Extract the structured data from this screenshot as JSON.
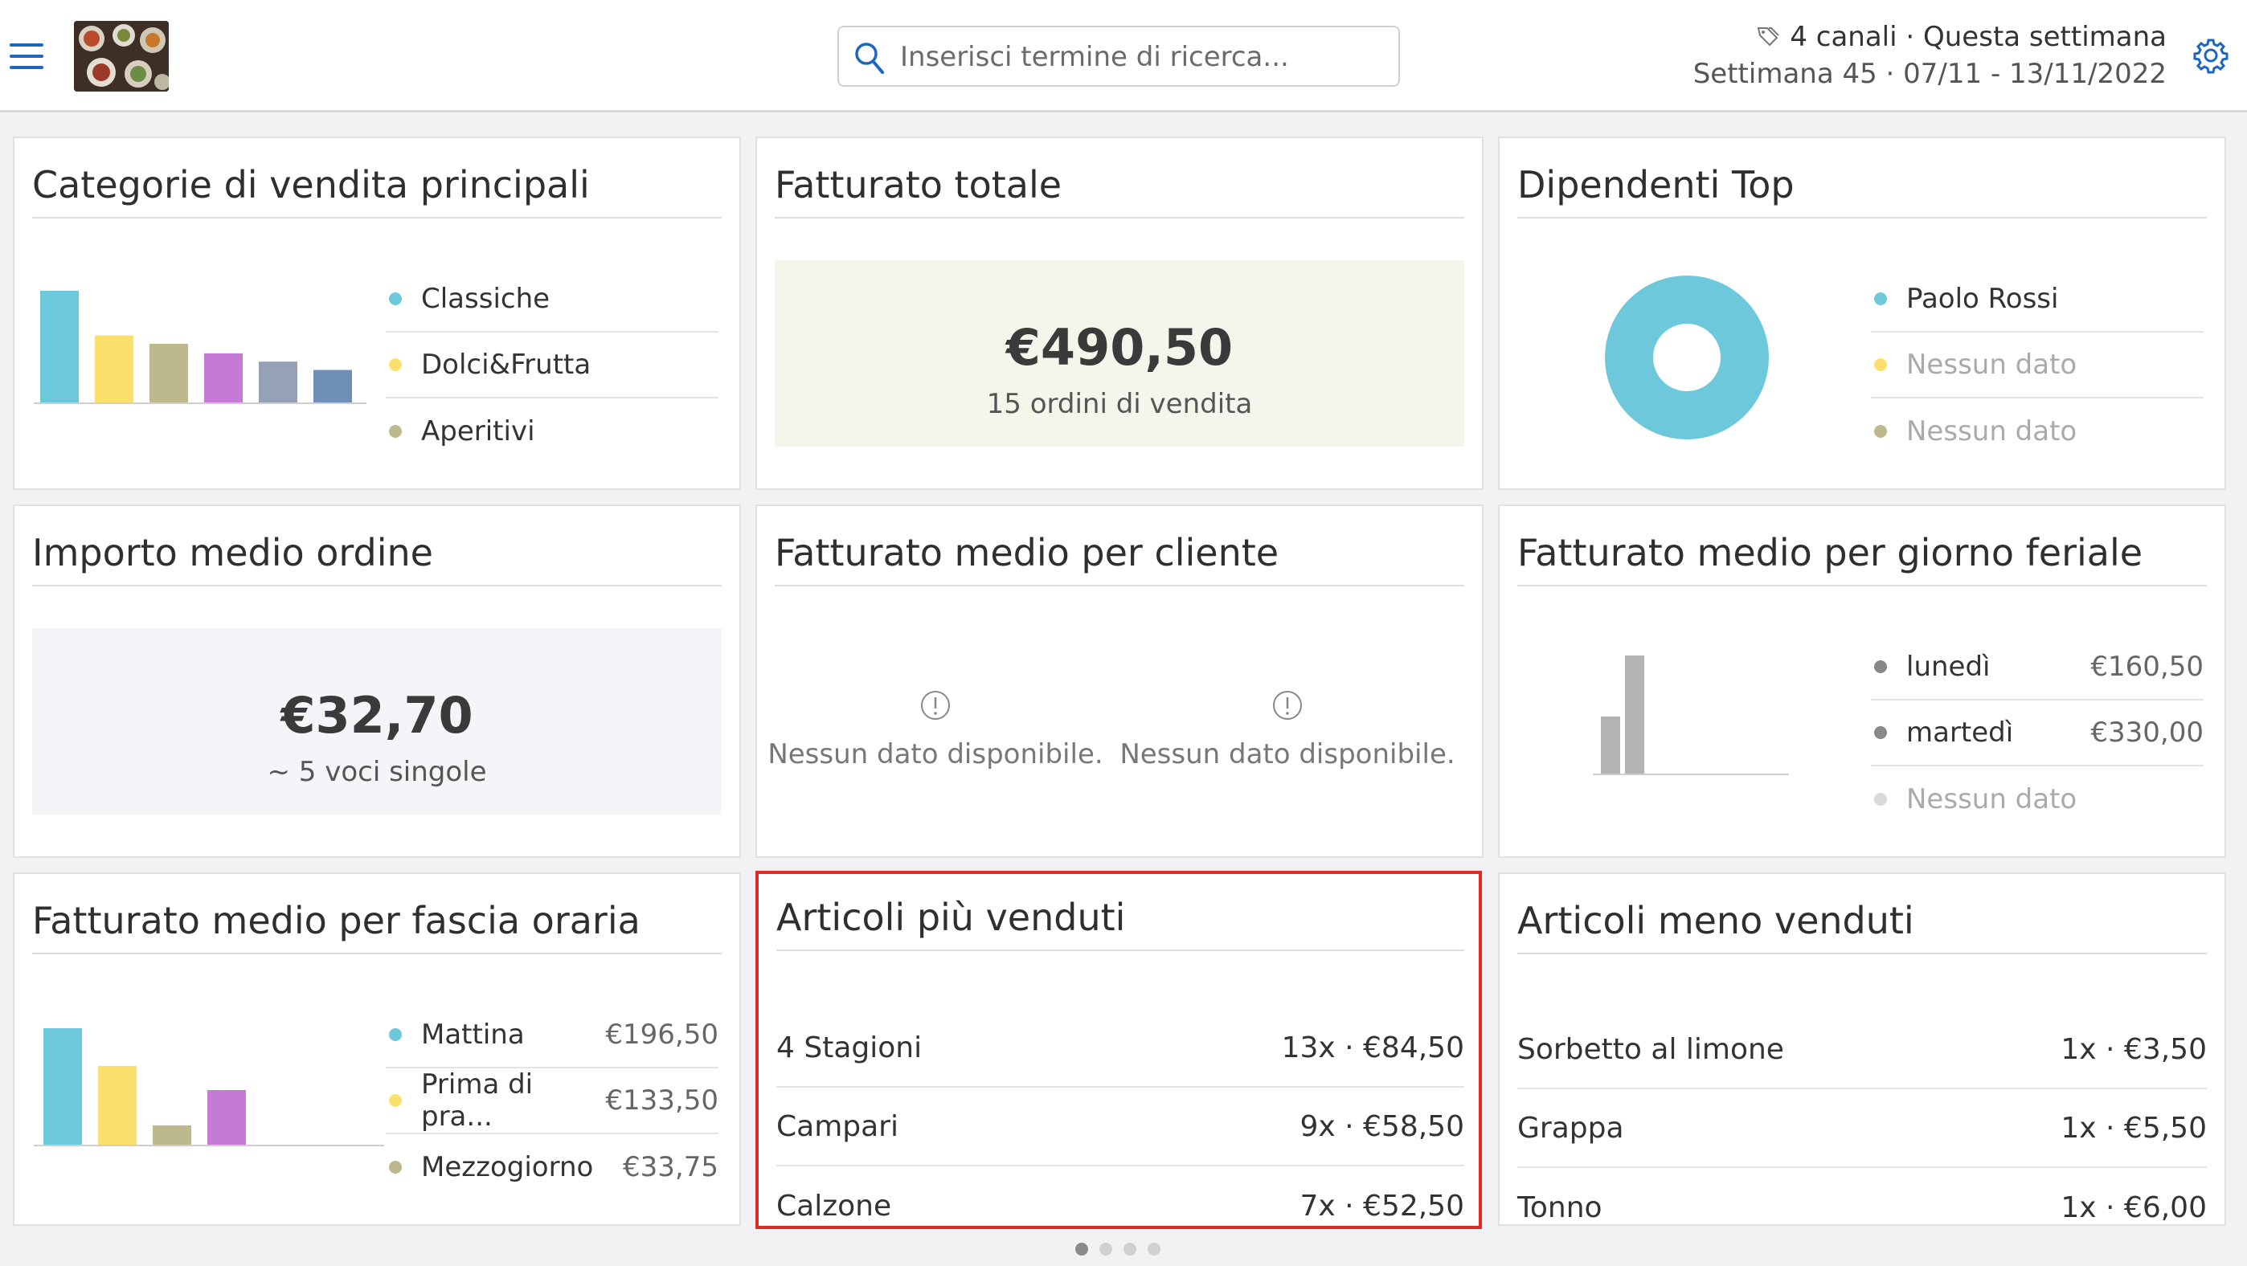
{
  "header": {
    "search_placeholder": "Inserisci termine di ricerca...",
    "channels_label": "4 canali · Questa settimana",
    "week_label": "Settimana 45 · 07/11 - 13/11/2022"
  },
  "colors": {
    "accent": "#1f66c1",
    "highlight_border": "#e02b27",
    "series": [
      "#6ec8dc",
      "#fbe06e",
      "#bdb98c",
      "#c57ad6",
      "#94a1b6",
      "#6f8fb8"
    ]
  },
  "cards": {
    "top_categories": {
      "title": "Categorie di vendita principali",
      "legend": [
        "Classiche",
        "Dolci&Frutta",
        "Aperitivi"
      ]
    },
    "total_revenue": {
      "title": "Fatturato totale",
      "value": "€490,50",
      "sub": "15 ordini di vendita"
    },
    "top_employees": {
      "title": "Dipendenti Top",
      "legend": [
        "Paolo Rossi",
        "Nessun dato",
        "Nessun dato"
      ]
    },
    "avg_order": {
      "title": "Importo medio ordine",
      "value": "€32,70",
      "sub": "~ 5 voci singole"
    },
    "avg_per_customer": {
      "title": "Fatturato medio per cliente",
      "nodata_left": "Nessun dato disponibile.",
      "nodata_right": "Nessun dato disponibile."
    },
    "avg_per_weekday": {
      "title": "Fatturato medio per giorno feriale",
      "rows": [
        {
          "label": "lunedì",
          "value": "€160,50"
        },
        {
          "label": "martedì",
          "value": "€330,00"
        },
        {
          "label": "Nessun dato",
          "value": ""
        }
      ]
    },
    "avg_per_timeslot": {
      "title": "Fatturato medio per fascia oraria",
      "rows": [
        {
          "label": "Mattina",
          "value": "€196,50"
        },
        {
          "label": "Prima di pra...",
          "value": "€133,50"
        },
        {
          "label": "Mezzogiorno",
          "value": "€33,75"
        }
      ]
    },
    "best_sellers": {
      "title": "Articoli più venduti",
      "rows": [
        {
          "name": "4 Stagioni",
          "value": "13x · €84,50"
        },
        {
          "name": "Campari",
          "value": "9x · €58,50"
        },
        {
          "name": "Calzone",
          "value": "7x · €52,50"
        }
      ]
    },
    "worst_sellers": {
      "title": "Articoli meno venduti",
      "rows": [
        {
          "name": "Sorbetto al limone",
          "value": "1x · €3,50"
        },
        {
          "name": "Grappa",
          "value": "1x · €5,50"
        },
        {
          "name": "Tonno",
          "value": "1x · €6,00"
        }
      ]
    }
  },
  "pagination": {
    "pages": 4,
    "active": 1
  }
}
